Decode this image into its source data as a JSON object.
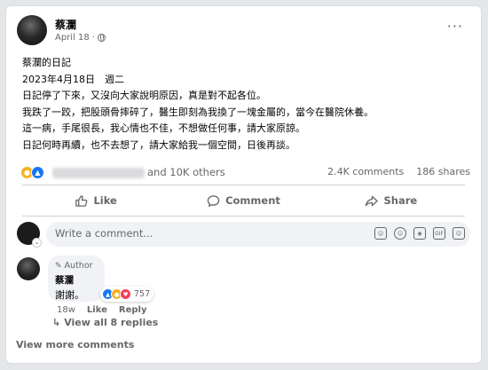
{
  "post": {
    "author": "蔡瀾",
    "date": "April 18",
    "dot": "·",
    "more": "···",
    "lines": [
      "蔡瀾的日記",
      "2023年4月18日　週二",
      "日記停了下來，又沒向大家說明原因，真是對不起各位。",
      "我跌了一跤，把股頭骨摔碎了，醫生即刻為我換了一塊金屬的，當今在醫院休養。",
      "這一病，手尾很長，我心情也不佳，不想做任何事，請大家原諒。",
      "日記何時再續，也不去想了，請大家給我一個空間，日後再談。"
    ]
  },
  "reactions": {
    "others": "and 10K others",
    "comments": "2.4K comments",
    "shares": "186 shares"
  },
  "actions": {
    "like": "Like",
    "comment": "Comment",
    "share": "Share"
  },
  "composer": {
    "placeholder": "Write a comment..."
  },
  "reply": {
    "author_tag": "Author",
    "name": "蔡瀾",
    "text": "謝謝。",
    "react_count": "757",
    "time": "18w",
    "like": "Like",
    "reply": "Reply"
  },
  "view_replies": "View all 8 replies",
  "view_more": "View more comments"
}
